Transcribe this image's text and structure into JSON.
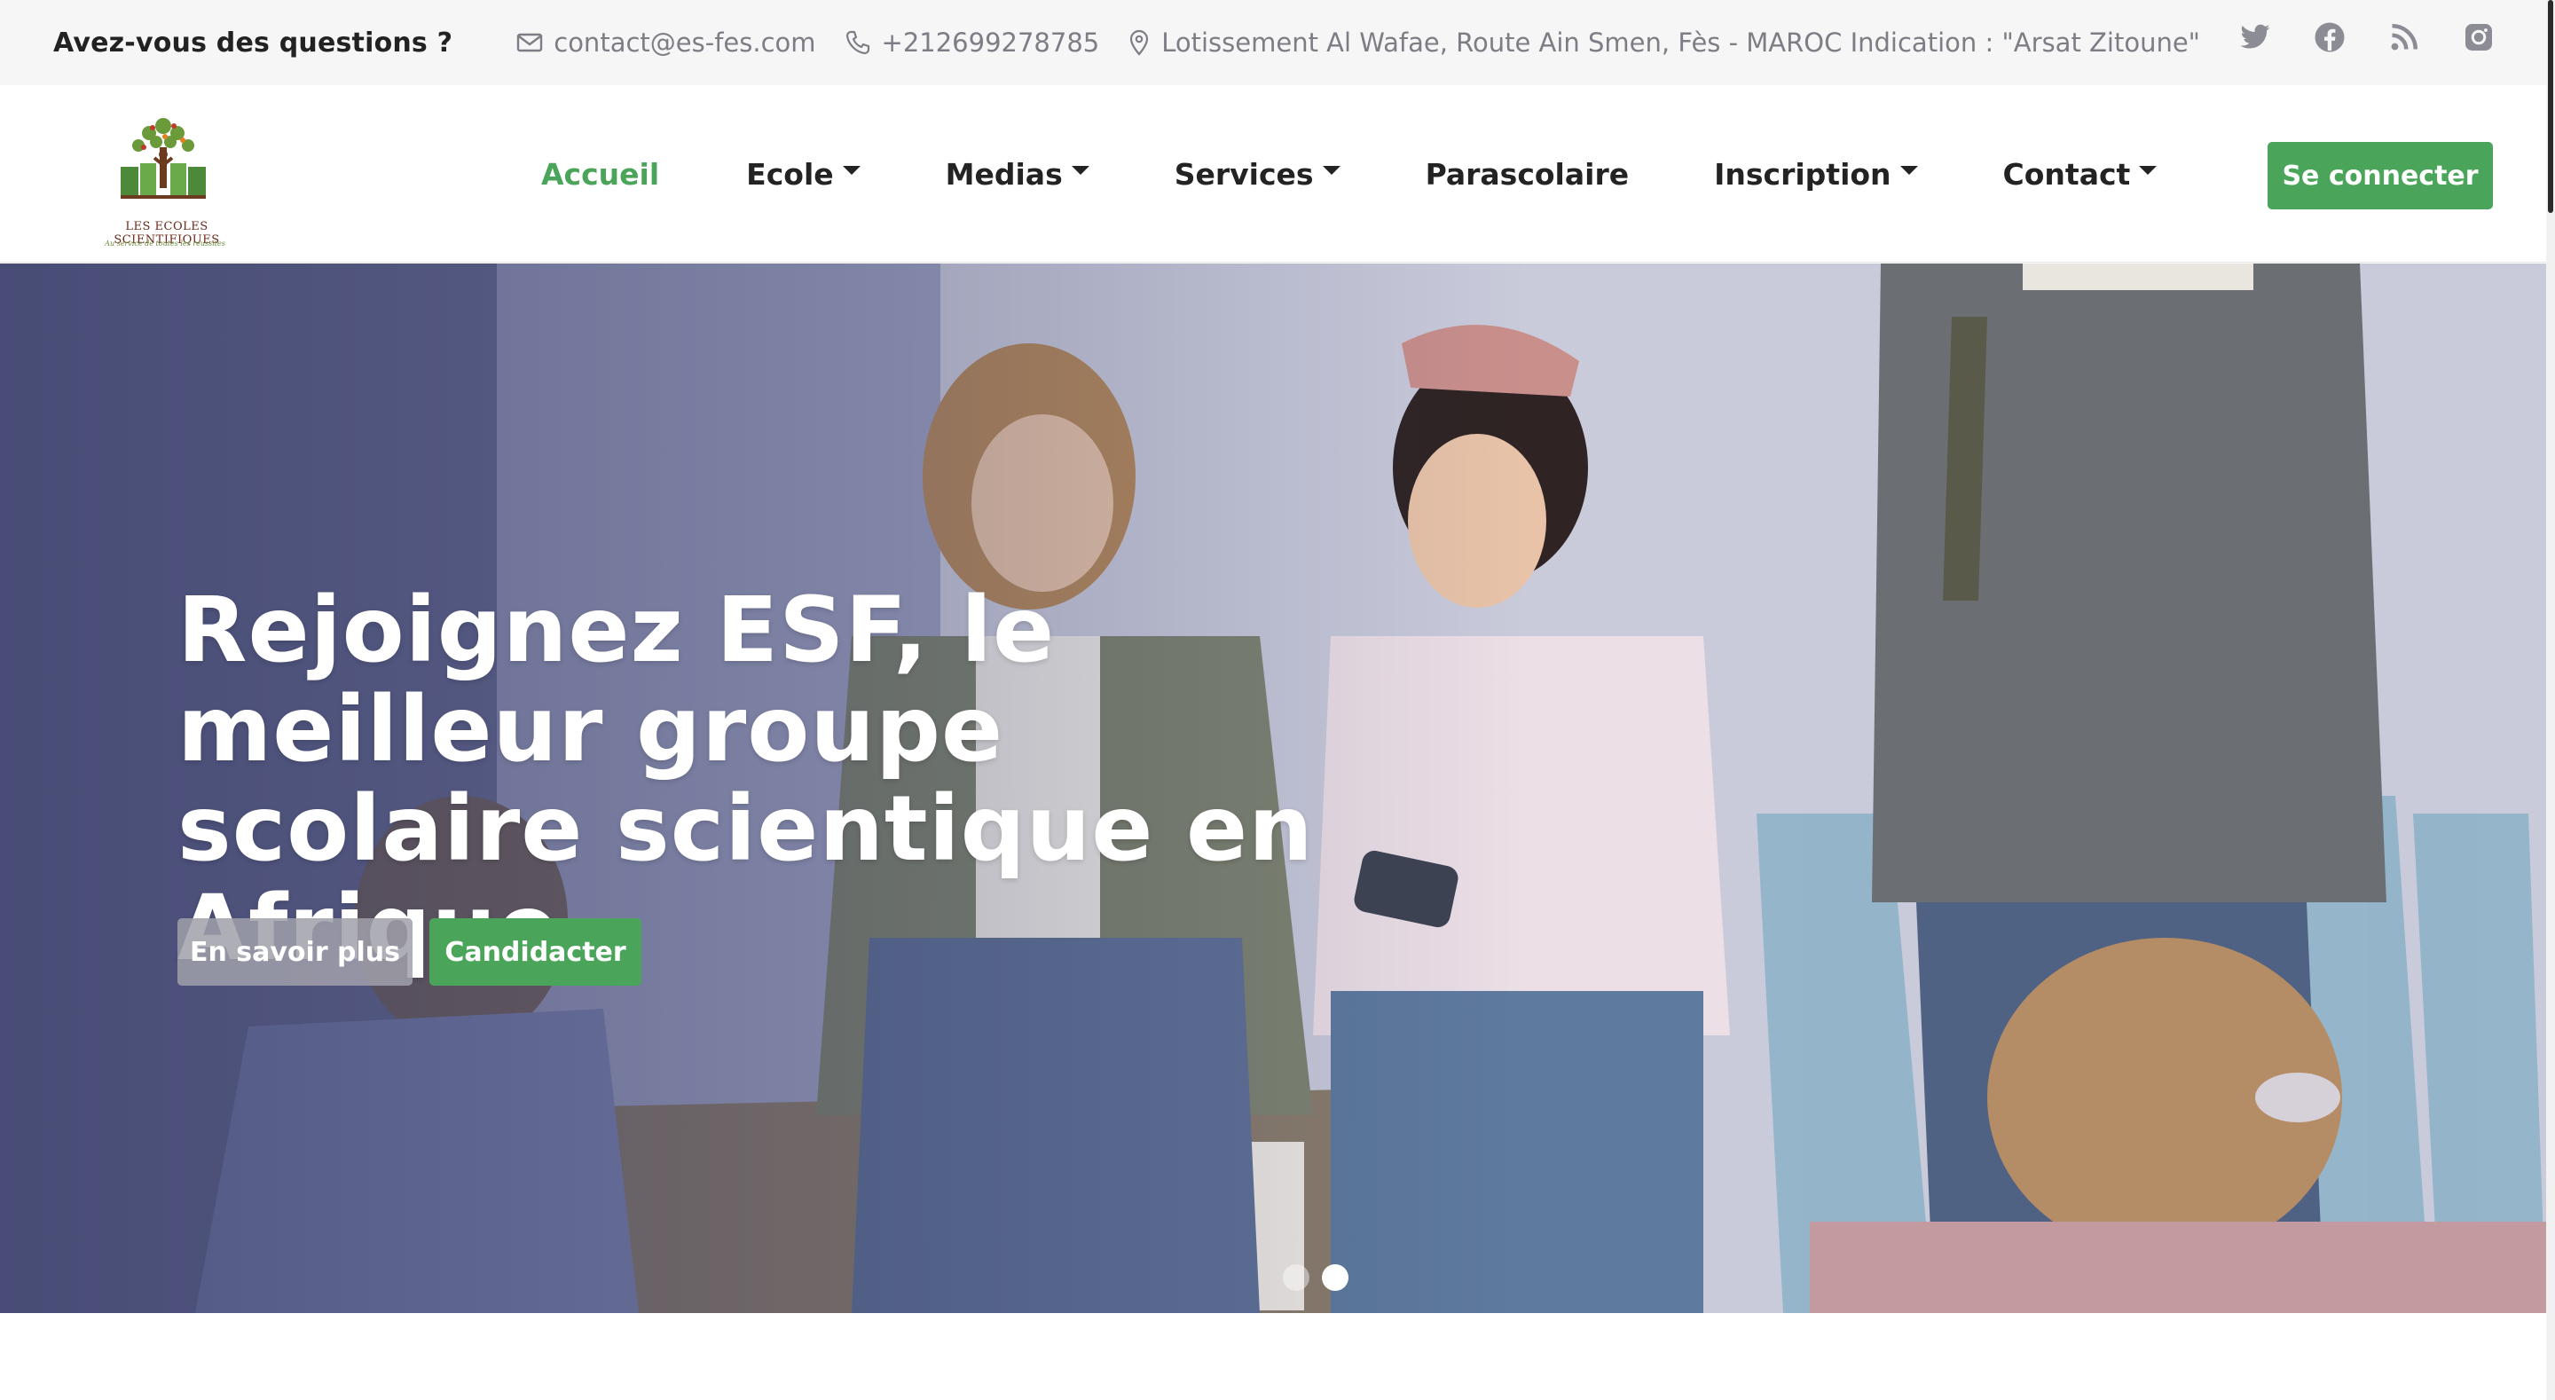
{
  "topbar": {
    "question": "Avez-vous des questions ?",
    "email": "contact@es-fes.com",
    "phone": "+212699278785",
    "address": "Lotissement Al Wafae, Route Ain Smen, Fès - MAROC Indication : \"Arsat Zitoune\"",
    "socials": [
      "twitter-icon",
      "facebook-icon",
      "rss-icon",
      "instagram-icon"
    ]
  },
  "logo": {
    "name": "LES ECOLES SCIENTIFIQUES",
    "tagline": "Au service de toutes les réussites"
  },
  "nav": {
    "items": [
      {
        "label": "Accueil",
        "active": true,
        "dropdown": false
      },
      {
        "label": "Ecole",
        "active": false,
        "dropdown": true
      },
      {
        "label": "Medias",
        "active": false,
        "dropdown": true
      },
      {
        "label": "Services",
        "active": false,
        "dropdown": true
      },
      {
        "label": "Parascolaire",
        "active": false,
        "dropdown": false
      },
      {
        "label": "Inscription",
        "active": false,
        "dropdown": true
      },
      {
        "label": "Contact",
        "active": false,
        "dropdown": true
      }
    ],
    "connect_label": "Se connecter"
  },
  "hero": {
    "title": "Rejoignez ESF, le meilleur groupe scolaire scientique en Afrique",
    "more_label": "En savoir plus",
    "apply_label": "Candidacter",
    "slides": 2,
    "active_slide": 2
  },
  "colors": {
    "accent": "#4aa55b",
    "text": "#232323",
    "muted": "#7d7d85",
    "topbar_bg": "#f6f6f7"
  }
}
